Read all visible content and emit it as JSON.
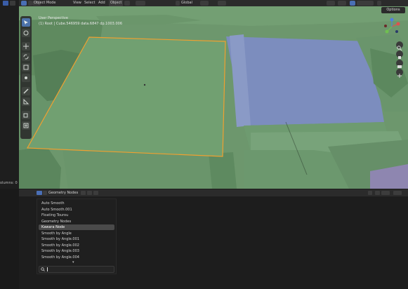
{
  "header": {
    "mode": "Object Mode",
    "menus": [
      "View",
      "Select",
      "Add",
      "Object"
    ],
    "orientation": "Global",
    "options": "Options"
  },
  "viewport": {
    "perspective": "User Perspective",
    "collection": "(1) Root | Cube.546959 data.6847 dp.1003.006"
  },
  "left_panel": {
    "columns_label": "olumns: 0"
  },
  "node_editor": {
    "title": "Geometry Nodes",
    "groups": [
      "Auto Smooth",
      "Auto Smooth.001",
      "Floating Tourou",
      "Geometry Nodes",
      "Kawara Node",
      "Smooth by Angle",
      "Smooth by Angle.001",
      "Smooth by Angle.002",
      "Smooth by Angle.003",
      "Smooth by Angle.004"
    ],
    "highlighted_index": 4,
    "search_placeholder": ""
  },
  "colors": {
    "selection_outline": "#f0a030",
    "ground_green": "#6f9a6f",
    "roof_blue": "#7a8fc0",
    "ui_dark": "#1d1d1d"
  }
}
